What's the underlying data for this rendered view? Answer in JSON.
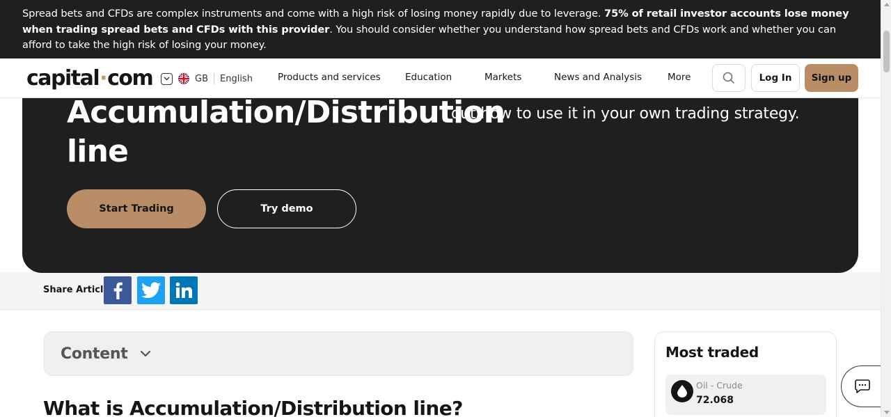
{
  "risk_warning": {
    "text_start": "Spread bets and CFDs are complex instruments and come with a high risk of losing money rapidly due to leverage. ",
    "text_bold": "75% of retail investor accounts lose money when trading spread bets and CFDs with this provider",
    "text_end": ". You should consider whether you understand how spread bets and CFDs work and whether you can afford to take the high risk of losing your money."
  },
  "header": {
    "logo_left": "capital",
    "logo_dot": "·",
    "logo_right": "com",
    "country": "GB",
    "language": "English",
    "nav": {
      "products": "Products and services",
      "education": "Education",
      "markets": "Markets",
      "news": "News and Analysis",
      "more": "More"
    },
    "login_label": "Log In",
    "signup_label": "Sign up",
    "icons": {
      "search": "search-icon",
      "locale_caret": "chevron-down-icon",
      "flag": "uk-flag-icon"
    }
  },
  "hero": {
    "title": "Accumulation/Distribution line",
    "description": "Accumulation/Distribution indicator and find out how to use it in your own trading strategy.",
    "start_trading_label": "Start Trading",
    "try_demo_label": "Try demo"
  },
  "share": {
    "label": "Share Article",
    "icons": [
      "facebook-icon",
      "twitter-icon",
      "linkedin-icon"
    ]
  },
  "content": {
    "toc_label": "Content",
    "heading": "What is Accumulation/Distribution line?"
  },
  "most_traded": {
    "title": "Most traded",
    "items": [
      {
        "name": "Oil - Crude",
        "price": "72.068",
        "icon": "oil-drop-icon"
      }
    ]
  },
  "colors": {
    "dark_bg": "#1f1f1f",
    "accent": "#b98e66",
    "facebook": "#3b5998",
    "twitter": "#1da1f2",
    "linkedin": "#0077b5"
  }
}
